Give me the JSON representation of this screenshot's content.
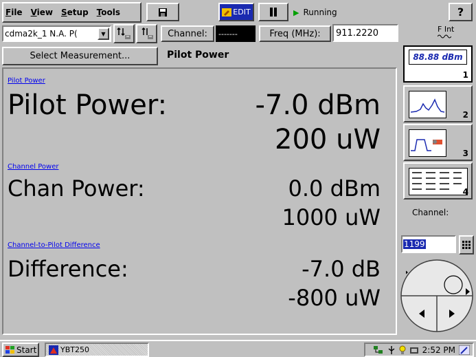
{
  "menu": {
    "items": [
      {
        "pre": "",
        "ul": "F",
        "post": "ile"
      },
      {
        "pre": "",
        "ul": "V",
        "post": "iew"
      },
      {
        "pre": "",
        "ul": "S",
        "post": "etup"
      },
      {
        "pre": "",
        "ul": "T",
        "post": "ools"
      }
    ]
  },
  "toolbar": {
    "edit_label": "EDIT",
    "status": "Running",
    "help_label": "?"
  },
  "row2": {
    "standard_value": "cdma2k_1 N.A. P(",
    "channel_label": "Channel:",
    "channel_value": "-------",
    "freq_label": "Freq (MHz):",
    "freq_value": "911.2220",
    "fint_label": "F Int"
  },
  "row3": {
    "select_label": "Select Measurement...",
    "measurement_title": "Pilot Power"
  },
  "measurements": [
    {
      "link": "Pilot Power",
      "label": "Pilot Power:",
      "value1": "-7.0 dBm",
      "value2": "200 uW"
    },
    {
      "link": "Channel Power",
      "label": "Chan Power:",
      "value1": "0.0 dBm",
      "value2": "1000 uW"
    },
    {
      "link": "Channel-to-Pilot Difference",
      "label": "Difference:",
      "value1": "-7.0 dB",
      "value2": "-800 uW"
    }
  ],
  "sidebar": {
    "readout_text": "88.88 dBm",
    "readout_num": "1",
    "btn2_num": "2",
    "btn3_num": "3",
    "btn4_num": "4",
    "channel_label": "Channel:",
    "channel_input": "1199"
  },
  "taskbar": {
    "start_label": "Start",
    "task_label": "YBT250",
    "clock": "2:52 PM"
  },
  "colors": {
    "window_bg": "#c0c0c0",
    "accent_blue": "#1a2ab0",
    "link_blue": "#0000ee"
  }
}
